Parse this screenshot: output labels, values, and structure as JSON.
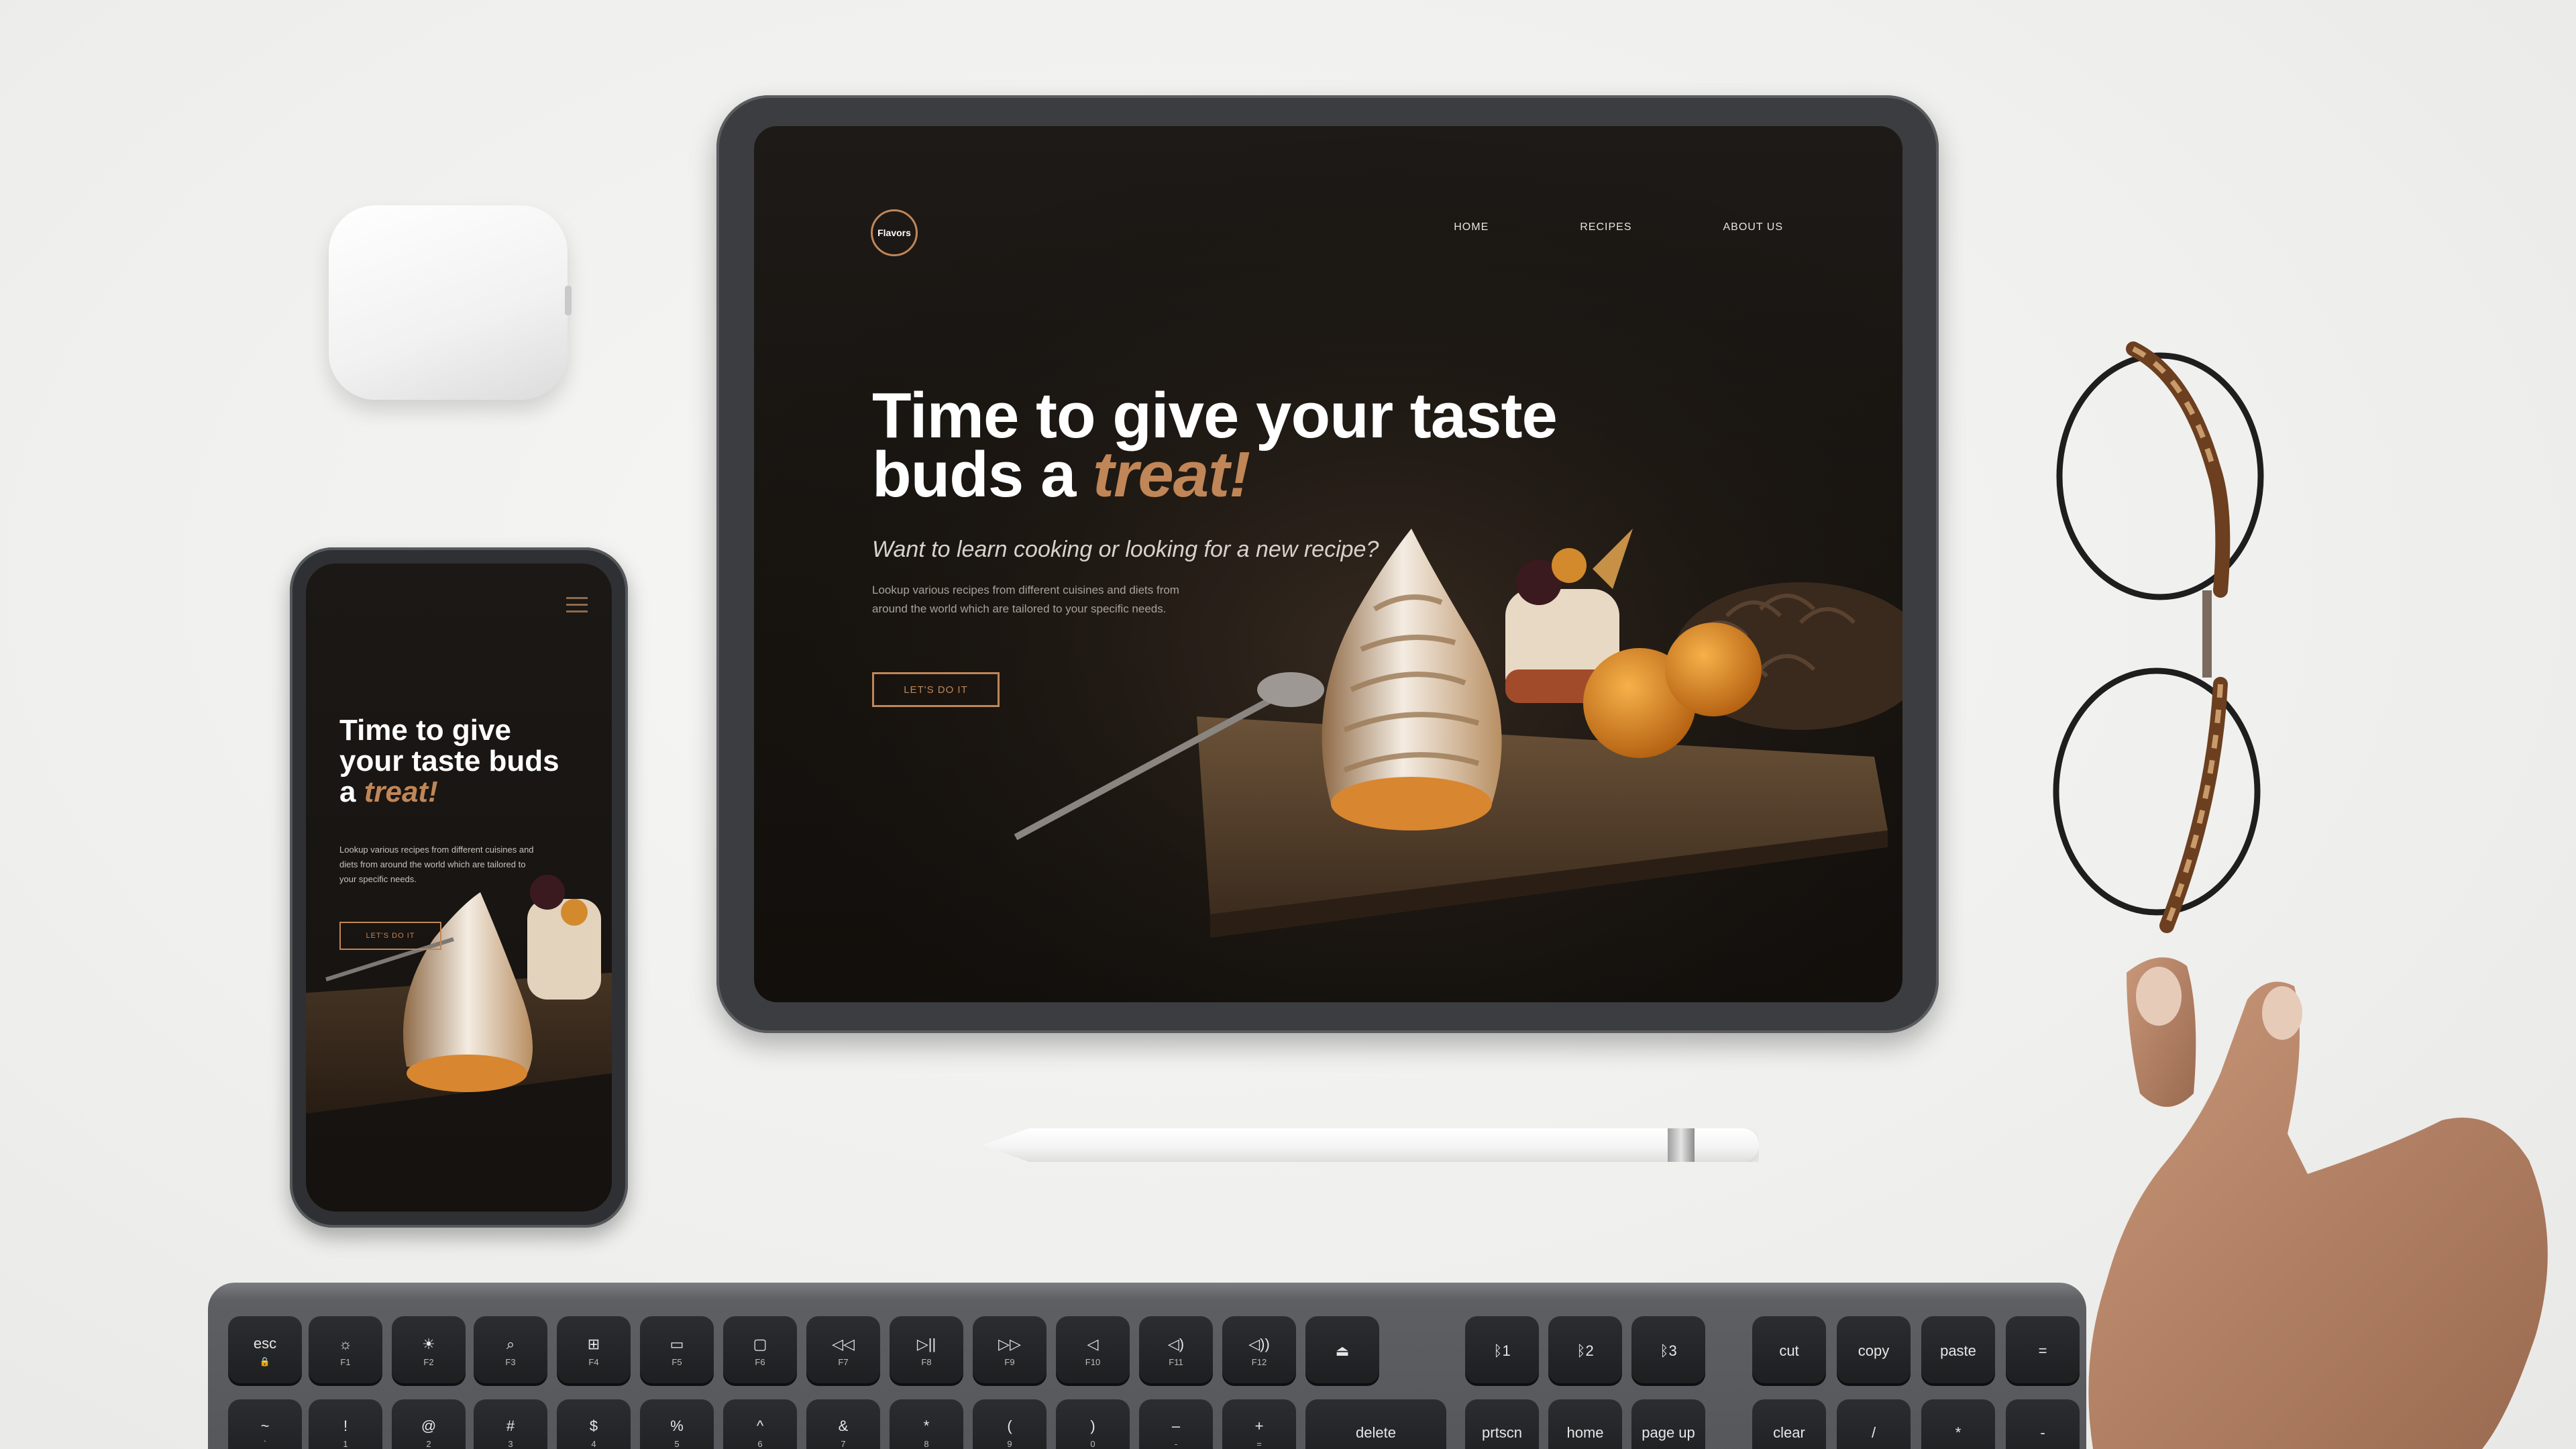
{
  "tablet_site": {
    "logo": "Flavors",
    "nav": [
      "HOME",
      "RECIPES",
      "ABOUT US"
    ],
    "headline_line1": "Time to give your taste",
    "headline_line2_prefix": "buds a ",
    "headline_accent": "treat!",
    "subheading": "Want to learn cooking or looking for a new recipe?",
    "description": "Lookup various recipes from different cuisines and diets from around the world which are tailored to your specific needs.",
    "cta": "LET'S DO IT"
  },
  "phone_site": {
    "headline_line1": "Time to give",
    "headline_line2": "your taste buds",
    "headline_line3_prefix": "a ",
    "headline_accent": "treat!",
    "description": "Lookup various recipes from different cuisines and diets from around the world which are tailored to your specific needs.",
    "cta": "LET'S DO IT"
  },
  "keyboard": {
    "fn_row": [
      {
        "label": "esc",
        "sub": "🔒"
      },
      {
        "label": "☼",
        "sub": "F1"
      },
      {
        "label": "☀",
        "sub": "F2"
      },
      {
        "label": "⌕",
        "sub": "F3"
      },
      {
        "label": "⊞",
        "sub": "F4"
      },
      {
        "label": "▭",
        "sub": "F5"
      },
      {
        "label": "▢",
        "sub": "F6"
      },
      {
        "label": "◁◁",
        "sub": "F7"
      },
      {
        "label": "▷||",
        "sub": "F8"
      },
      {
        "label": "▷▷",
        "sub": "F9"
      },
      {
        "label": "◁",
        "sub": "F10"
      },
      {
        "label": "◁)",
        "sub": "F11"
      },
      {
        "label": "◁))",
        "sub": "F12"
      },
      {
        "label": "⏏",
        "sub": ""
      },
      {
        "label": "ᛒ1",
        "sub": ""
      },
      {
        "label": "ᛒ2",
        "sub": ""
      },
      {
        "label": "ᛒ3",
        "sub": ""
      },
      {
        "label": "cut",
        "sub": ""
      },
      {
        "label": "copy",
        "sub": ""
      },
      {
        "label": "paste",
        "sub": ""
      },
      {
        "label": "=",
        "sub": ""
      }
    ],
    "num_row": [
      {
        "label": "~",
        "sub": "`"
      },
      {
        "label": "!",
        "sub": "1"
      },
      {
        "label": "@",
        "sub": "2"
      },
      {
        "label": "#",
        "sub": "3"
      },
      {
        "label": "$",
        "sub": "4"
      },
      {
        "label": "%",
        "sub": "5"
      },
      {
        "label": "^",
        "sub": "6"
      },
      {
        "label": "&",
        "sub": "7"
      },
      {
        "label": "*",
        "sub": "8"
      },
      {
        "label": "(",
        "sub": "9"
      },
      {
        "label": ")",
        "sub": "0"
      },
      {
        "label": "–",
        "sub": "-"
      },
      {
        "label": "+",
        "sub": "="
      },
      {
        "label": "delete",
        "sub": ""
      },
      {
        "label": "prtscn",
        "sub": ""
      },
      {
        "label": "home",
        "sub": ""
      },
      {
        "label": "page up",
        "sub": ""
      },
      {
        "label": "clear",
        "sub": ""
      },
      {
        "label": "/",
        "sub": ""
      },
      {
        "label": "*",
        "sub": ""
      },
      {
        "label": "-",
        "sub": ""
      }
    ]
  },
  "colors": {
    "accent": "#c08657",
    "screen_bg": "#17130f",
    "desk": "#f2f2f0"
  }
}
